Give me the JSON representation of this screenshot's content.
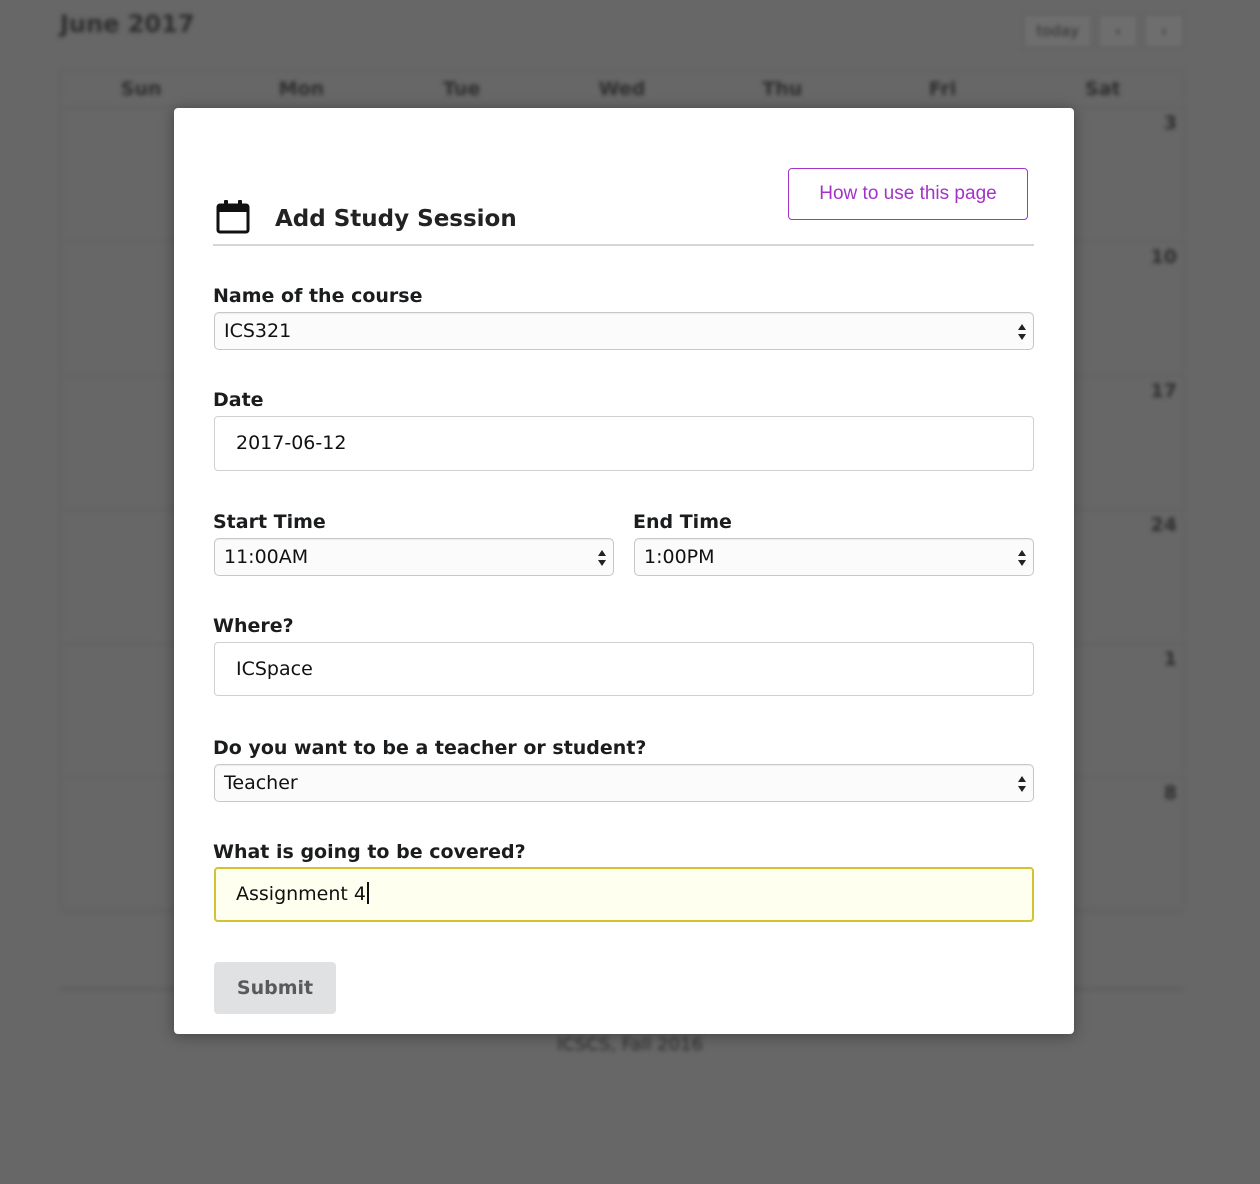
{
  "background": {
    "title": "June 2017",
    "buttons": [
      "today",
      "‹",
      "›"
    ],
    "weekdays": [
      "Sun",
      "Mon",
      "Tue",
      "Wed",
      "Thu",
      "Fri",
      "Sat"
    ],
    "row_last_numbers": [
      "3",
      "10",
      "17",
      "24",
      "1",
      "8"
    ],
    "footer": "ICSCS, Fall 2016"
  },
  "modal": {
    "icon": "calendar-icon",
    "title": "Add Study Session",
    "help_button": "How to use this page",
    "course": {
      "label": "Name of the course",
      "value": "ICS321"
    },
    "date": {
      "label": "Date",
      "value": "2017-06-12"
    },
    "start_time": {
      "label": "Start Time",
      "value": "11:00AM"
    },
    "end_time": {
      "label": "End Time",
      "value": "1:00PM"
    },
    "where": {
      "label": "Where?",
      "value": "ICSpace"
    },
    "role": {
      "label": "Do you want to be a teacher or student?",
      "value": "Teacher"
    },
    "covered": {
      "label": "What is going to be covered?",
      "value": "Assignment 4"
    },
    "submit": "Submit"
  },
  "colors": {
    "accent": "#a333c8",
    "focus_border": "#d4c233",
    "overlay": "#676767"
  }
}
